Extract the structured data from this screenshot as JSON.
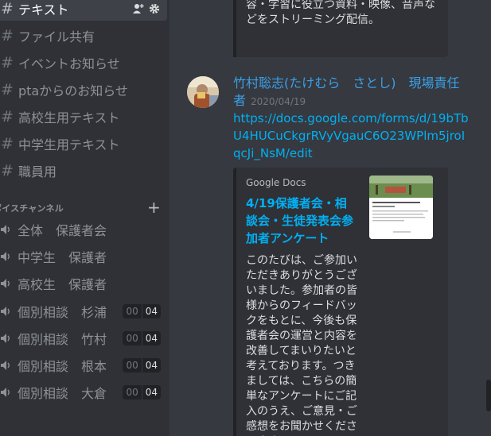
{
  "sidebar": {
    "text_channels": [
      {
        "label": "テキスト",
        "active": true
      },
      {
        "label": "ファイル共有"
      },
      {
        "label": "イベントお知らせ"
      },
      {
        "label": "ptaからのお知らせ"
      },
      {
        "label": "高校生用テキスト"
      },
      {
        "label": "中学生用テキスト"
      },
      {
        "label": "職員用"
      }
    ],
    "voice_category": "ボイスチャンネル",
    "voice_category_add": "+",
    "voice_channels": [
      {
        "label": "全体　保護者会"
      },
      {
        "label": "中学生　保護者"
      },
      {
        "label": "高校生　保護者"
      },
      {
        "label": "個別相談　杉浦",
        "current": "00",
        "limit": "04"
      },
      {
        "label": "個別相談　竹村",
        "current": "00",
        "limit": "04"
      },
      {
        "label": "個別相談　根本",
        "current": "00",
        "limit": "04"
      },
      {
        "label": "個別相談　大倉",
        "current": "00",
        "limit": "04"
      }
    ],
    "hash_symbol": "#"
  },
  "main": {
    "prev_embed_text": "容・学習に役立つ資料・映像、音声などをストリーミング配信。",
    "message": {
      "author": "竹村聡志(たけむら　さとし)　現場責任者",
      "timestamp": "2020/04/19",
      "link": "https://docs.google.com/forms/d/19bTbU4HUCuCkgrRVyVgauC6O23WPlm5jroIqcJi_NsM/edit",
      "embed": {
        "provider": "Google Docs",
        "title": "4/19保護者会・相談会・生徒発表会参加者アンケート",
        "description": "このたびは、ご参加いただきありがとうございました。参加者の皆様からのフィードバックをもとに、今後も保護者会の運営と内容を改善してまいりたいと考えております。つきましては、こちらの簡単なアンケートにご記入のうえ、ご意見・ご感想をお聞かせくださいます"
      }
    }
  },
  "colors": {
    "sidebar_bg": "#2f3136",
    "main_bg": "#36393f",
    "link": "#00b0f4",
    "author": "#3aa0e8"
  }
}
